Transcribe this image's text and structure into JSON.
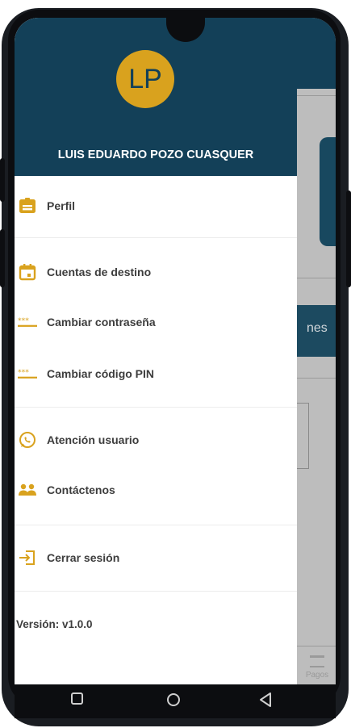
{
  "profile": {
    "initials": "LP",
    "name": "LUIS EDUARDO POZO CUASQUER"
  },
  "menu": {
    "items": [
      {
        "label": "Perfil",
        "icon": "profile-card-icon"
      },
      {
        "label": "Cuentas de destino",
        "icon": "calendar-icon"
      },
      {
        "label": "Cambiar contraseña",
        "icon": "password-dots-icon"
      },
      {
        "label": "Cambiar código PIN",
        "icon": "pin-dots-icon"
      },
      {
        "label": "Atención usuario",
        "icon": "whatsapp-icon"
      },
      {
        "label": "Contáctenos",
        "icon": "people-icon"
      },
      {
        "label": "Cerrar sesión",
        "icon": "logout-icon"
      }
    ]
  },
  "version": "Versión: v1.0.0",
  "background": {
    "tab_fragment": "nes",
    "bottom_tab": "Pagos"
  },
  "colors": {
    "header": "#134058",
    "accent": "#d9a21e",
    "text": "#3d3d3d"
  }
}
